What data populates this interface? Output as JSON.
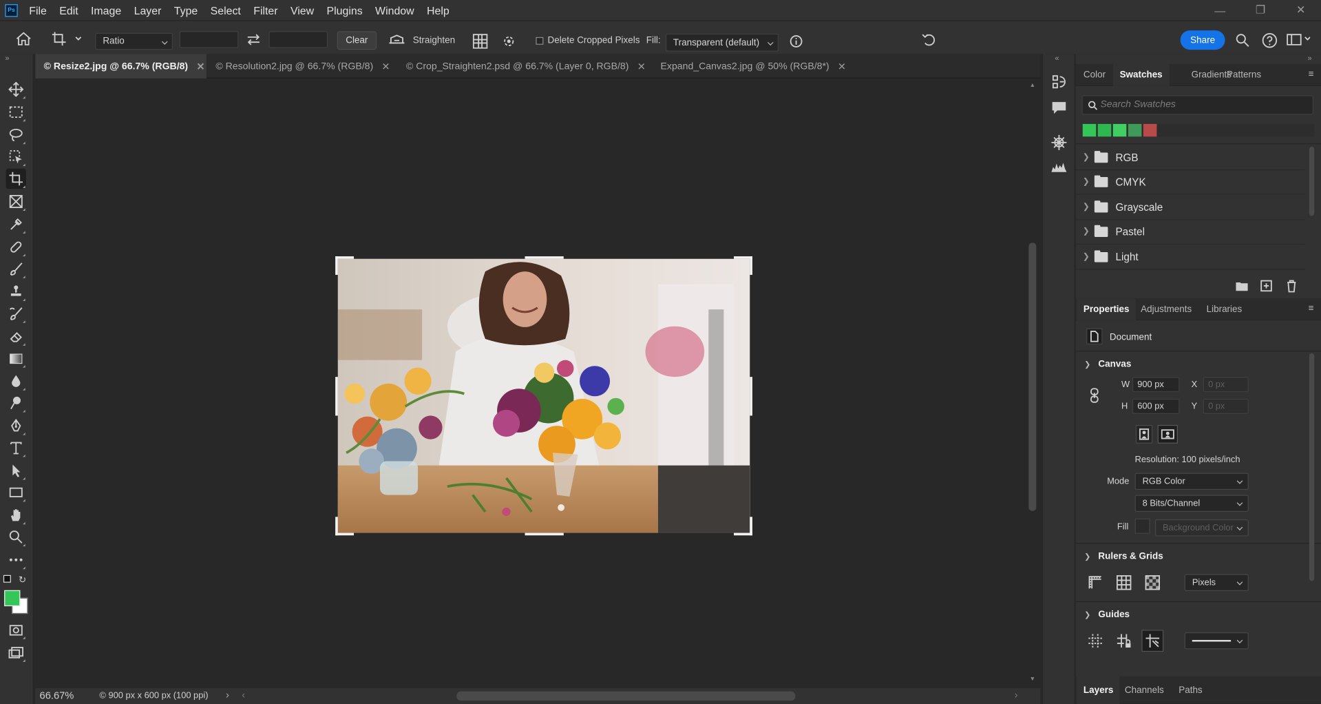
{
  "app": {
    "logo_text": "Ps"
  },
  "menu": [
    "File",
    "Edit",
    "Image",
    "Layer",
    "Type",
    "Select",
    "Filter",
    "View",
    "Plugins",
    "Window",
    "Help"
  ],
  "options": {
    "ratio_label": "Ratio",
    "ratio_width": "",
    "ratio_height": "",
    "clear_label": "Clear",
    "straighten_label": "Straighten",
    "delete_cropped_label": "Delete Cropped Pixels",
    "delete_cropped_checked": false,
    "fill_label": "Fill:",
    "fill_value": "Transparent (default)",
    "share_label": "Share"
  },
  "tabs": [
    {
      "label": "© Resize2.jpg @ 66.7% (RGB/8)",
      "active": true
    },
    {
      "label": "© Resolution2.jpg @ 66.7% (RGB/8)",
      "active": false
    },
    {
      "label": "© Crop_Straighten2.psd @ 66.7% (Layer 0, RGB/8)",
      "active": false
    },
    {
      "label": "Expand_Canvas2.jpg @ 50% (RGB/8*)",
      "active": false
    }
  ],
  "status": {
    "zoom": "66.67%",
    "doc_info": "900 px x 600 px (100 ppi)"
  },
  "swatches_panel": {
    "tabs": [
      "Color",
      "Swatches",
      "Gradients",
      "Patterns"
    ],
    "active_tab": "Swatches",
    "search_placeholder": "Search Swatches",
    "recent_colors": [
      "#35c65a",
      "#2fb851",
      "#3fcf63",
      "#3f9a5a",
      "#b84a4a"
    ],
    "groups": [
      "RGB",
      "CMYK",
      "Grayscale",
      "Pastel",
      "Light"
    ]
  },
  "properties_panel": {
    "tabs": [
      "Properties",
      "Adjustments",
      "Libraries"
    ],
    "active_tab": "Properties",
    "doc_label": "Document",
    "canvas_title": "Canvas",
    "w_label": "W",
    "w_value": "900 px",
    "h_label": "H",
    "h_value": "600 px",
    "x_label": "X",
    "x_value": "0 px",
    "y_label": "Y",
    "y_value": "0 px",
    "resolution": "Resolution: 100 pixels/inch",
    "mode_label": "Mode",
    "mode_value": "RGB Color",
    "bits_value": "8 Bits/Channel",
    "fill_label": "Fill",
    "fill_value": "Background Color",
    "rulers_title": "Rulers & Grids",
    "units_value": "Pixels",
    "guides_title": "Guides"
  },
  "bottom_tabs": [
    "Layers",
    "Channels",
    "Paths"
  ],
  "colors": {
    "foreground": "#35c65a",
    "background": "#ffffff",
    "share": "#1473e6"
  }
}
